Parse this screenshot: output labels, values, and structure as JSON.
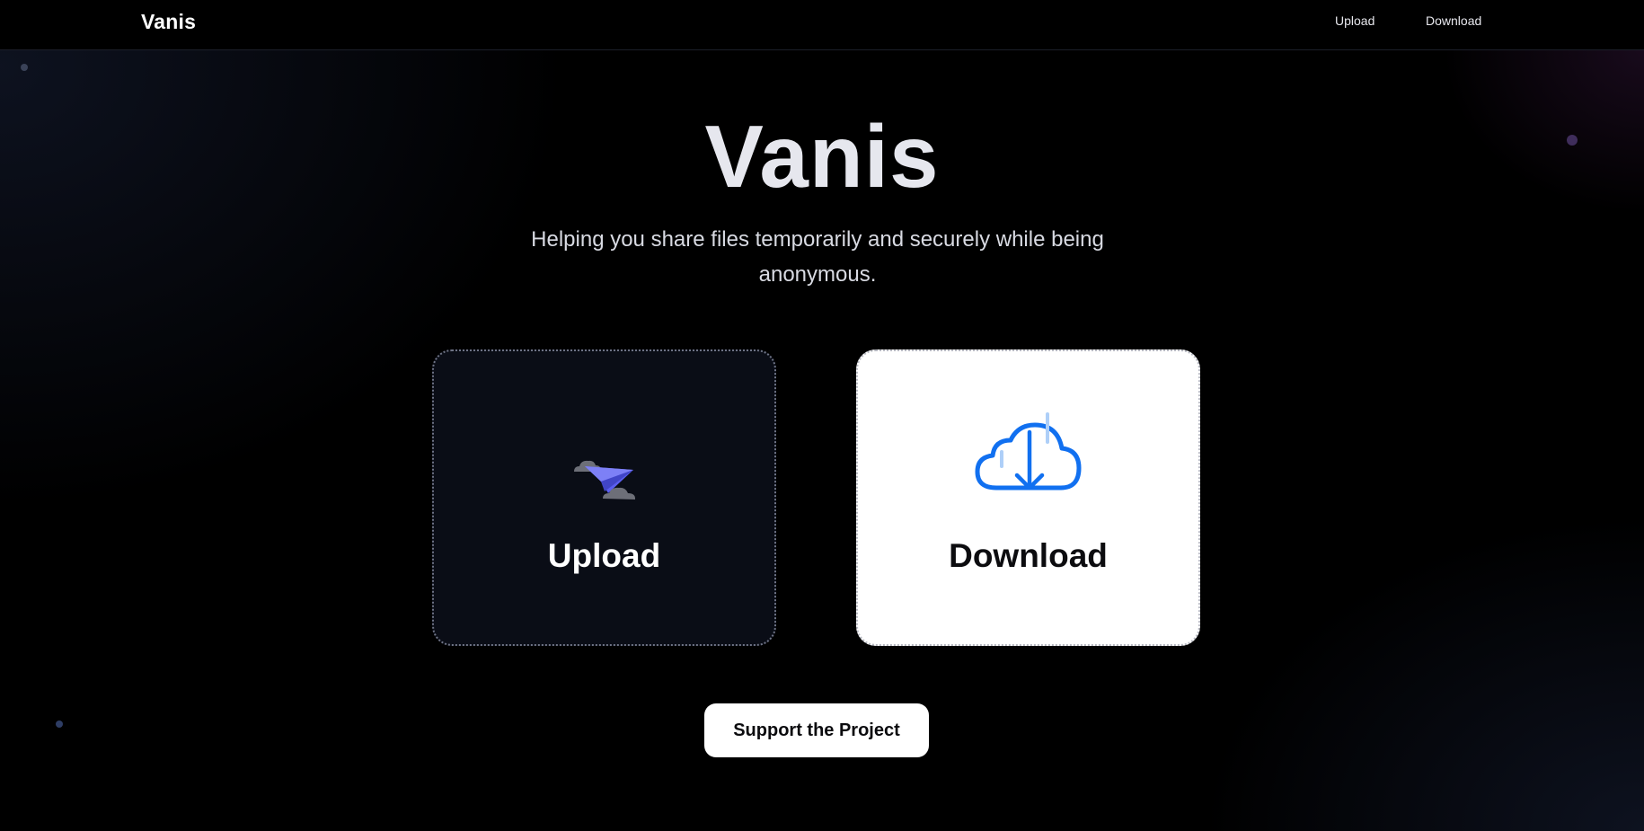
{
  "navbar": {
    "brand": "Vanis",
    "links": [
      {
        "label": "Upload"
      },
      {
        "label": "Download"
      }
    ]
  },
  "hero": {
    "title": "Vanis",
    "subtitle": "Helping you share files temporarily and securely while being anonymous."
  },
  "cards": {
    "upload": {
      "label": "Upload",
      "icon": "paper-plane-icon"
    },
    "download": {
      "label": "Download",
      "icon": "cloud-download-icon"
    }
  },
  "support": {
    "label": "Support the Project"
  },
  "colors": {
    "background": "#000000",
    "upload_card_bg": "#0a0d16",
    "download_card_bg": "#ffffff",
    "plane_accent": "#5b5ef0",
    "cloud_download_accent": "#1170f0"
  }
}
